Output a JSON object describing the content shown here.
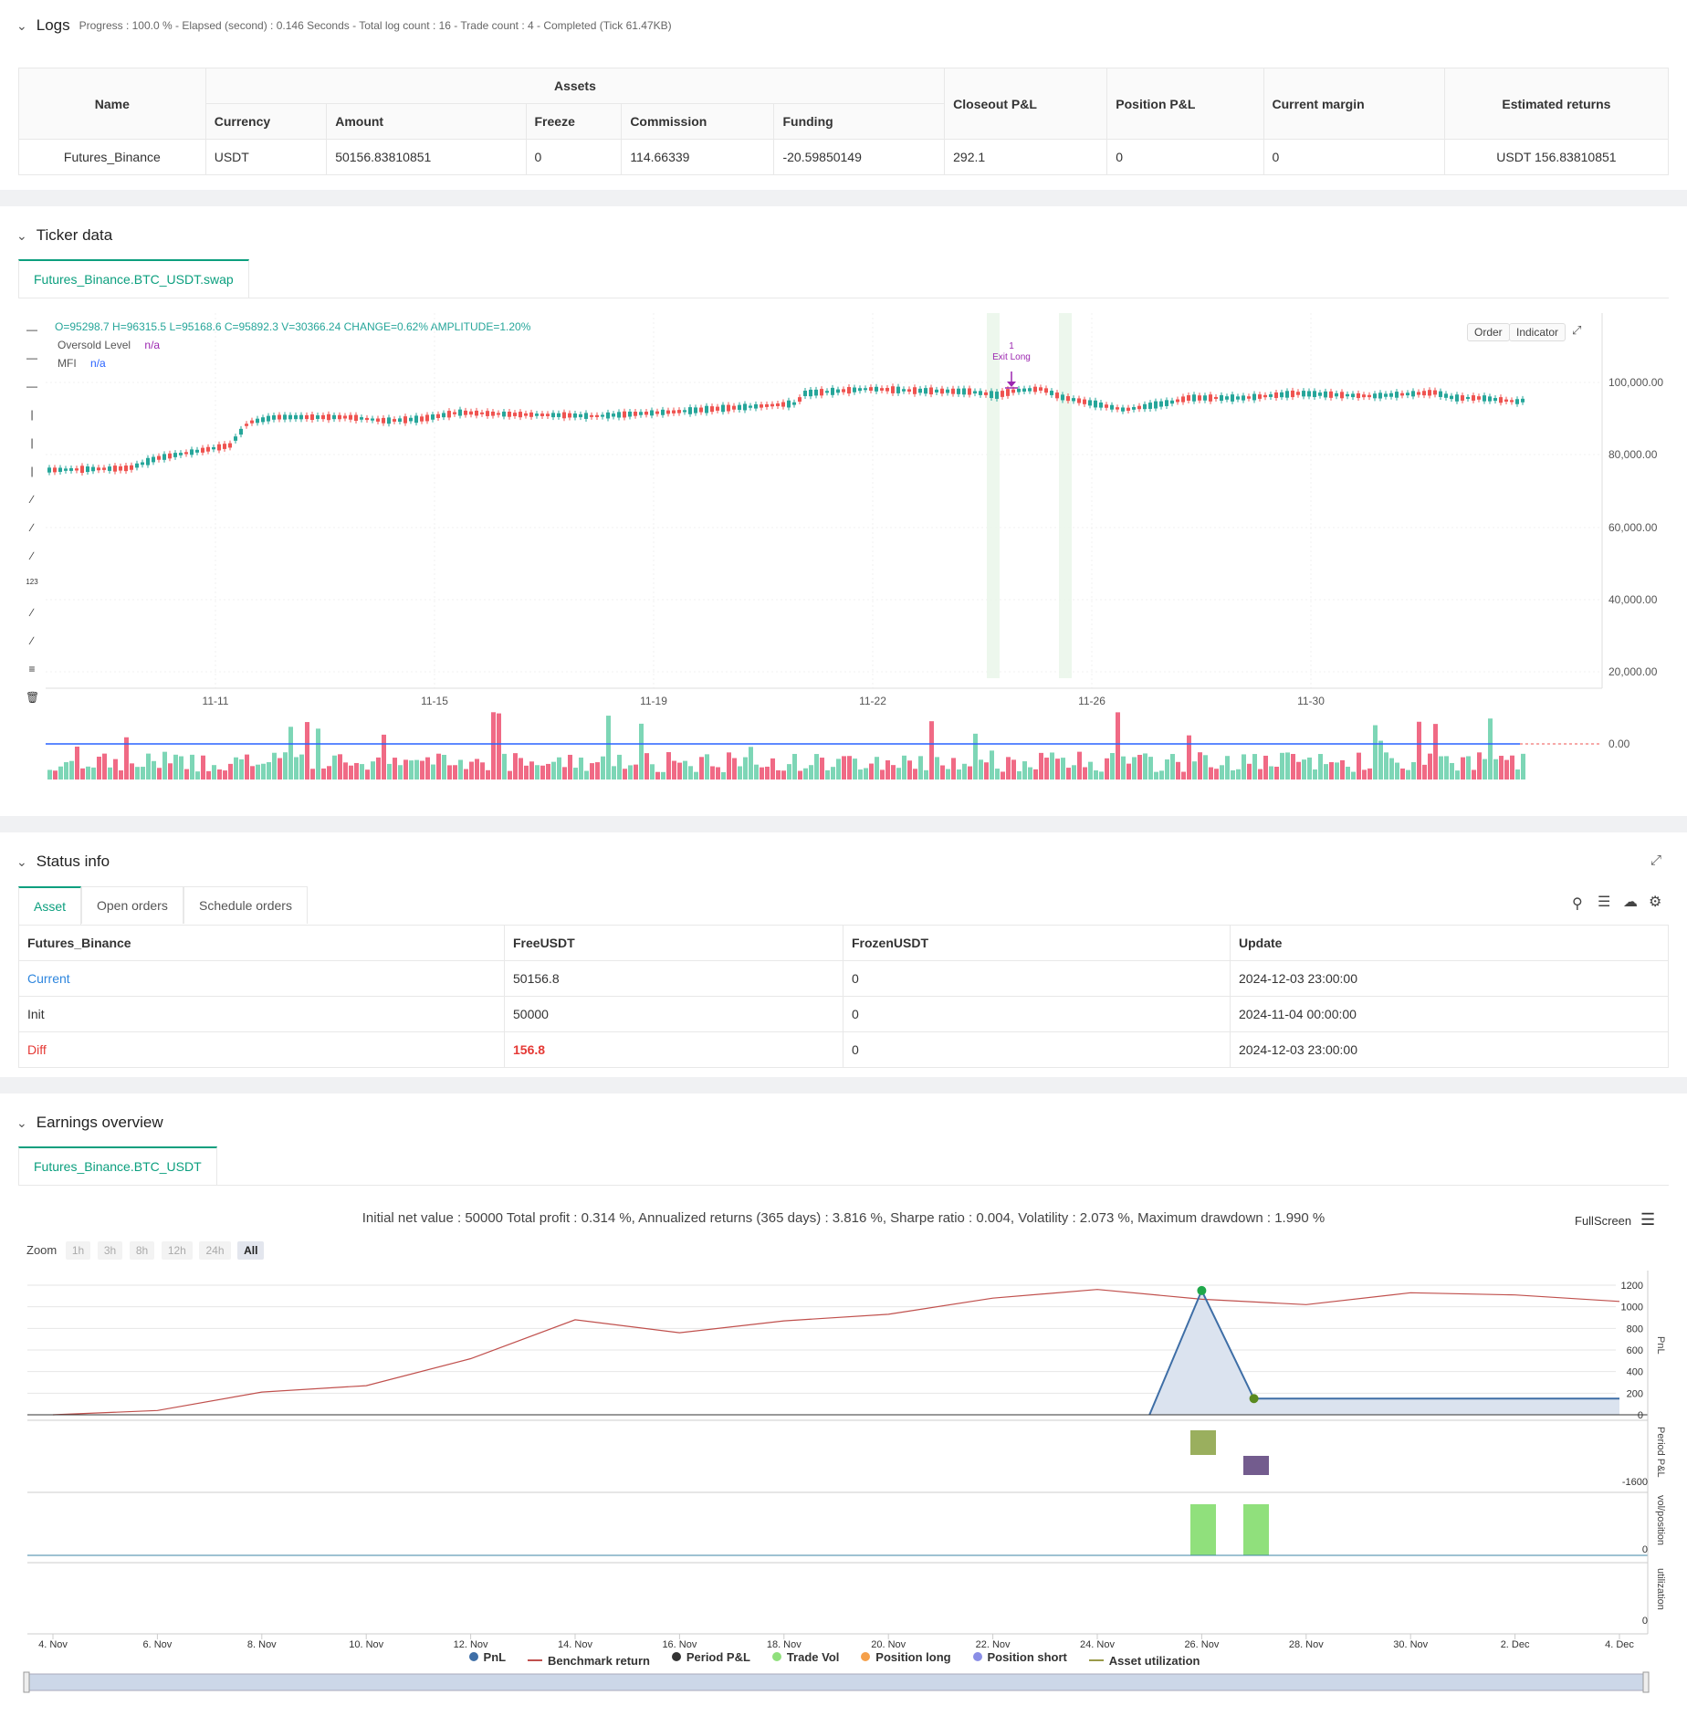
{
  "logs": {
    "title": "Logs",
    "summary": "Progress : 100.0 % - Elapsed (second) : 0.146  Seconds - Total log count : 16 - Trade count : 4 - Completed (Tick 61.47KB)",
    "table": {
      "h_name": "Name",
      "h_assets": "Assets",
      "h_currency": "Currency",
      "h_amount": "Amount",
      "h_freeze": "Freeze",
      "h_commission": "Commission",
      "h_funding": "Funding",
      "h_closeout": "Closeout P&L",
      "h_position": "Position P&L",
      "h_margin": "Current margin",
      "h_returns": "Estimated returns",
      "row": {
        "name": "Futures_Binance",
        "currency": "USDT",
        "amount": "50156.83810851",
        "freeze": "0",
        "commission": "114.66339",
        "funding": "-20.59850149",
        "closeout": "292.1",
        "position": "0",
        "margin": "0",
        "returns": "USDT 156.83810851"
      }
    }
  },
  "ticker": {
    "title": "Ticker data",
    "tab": "Futures_Binance.BTC_USDT.swap",
    "ohlc": "O=95298.7  H=96315.5  L=95168.6  C=95892.3  V=30366.24  CHANGE=0.62%  AMPLITUDE=1.20%",
    "oversold_label": "Oversold Level",
    "oversold_val": "n/a",
    "mfi_label": "MFI",
    "mfi_val": "n/a",
    "order_btn": "Order",
    "indicator_btn": "Indicator",
    "exit_mark": "1",
    "exit_label": "Exit Long",
    "y_ticks": [
      "100,000.00",
      "80,000.00",
      "60,000.00",
      "40,000.00",
      "20,000.00",
      "0.00"
    ],
    "x_ticks": [
      "11-11",
      "11-15",
      "11-19",
      "11-22",
      "11-26",
      "11-30"
    ]
  },
  "status": {
    "title": "Status info",
    "tabs": [
      "Asset",
      "Open orders",
      "Schedule orders"
    ],
    "headers": [
      "Futures_Binance",
      "FreeUSDT",
      "FrozenUSDT",
      "Update"
    ],
    "rows": [
      {
        "label": "Current",
        "free": "50156.8",
        "frozen": "0",
        "update": "2024-12-03 23:00:00"
      },
      {
        "label": "Init",
        "free": "50000",
        "frozen": "0",
        "update": "2024-11-04 00:00:00"
      },
      {
        "label": "Diff",
        "free": "156.8",
        "frozen": "0",
        "update": "2024-12-03 23:00:00"
      }
    ]
  },
  "earnings": {
    "title": "Earnings overview",
    "tab": "Futures_Binance.BTC_USDT",
    "summary": "Initial net value : 50000  Total profit : 0.314 %, Annualized returns (365 days) : 3.816 %, Sharpe ratio : 0.004, Volatility : 2.073 %, Maximum drawdown : 1.990 %",
    "fullscreen": "FullScreen",
    "zoom_label": "Zoom",
    "zoom_opts": [
      "1h",
      "3h",
      "8h",
      "12h",
      "24h",
      "All"
    ],
    "pnl_ticks": [
      "1200",
      "1000",
      "800",
      "600",
      "400",
      "200",
      "0"
    ],
    "period_tick": "-1600",
    "vol_tick": "0",
    "util_tick": "0",
    "axis_pnl": "PnL",
    "axis_period": "Period P&L",
    "axis_vol": "vol/position",
    "axis_util": "utilization",
    "x_ticks": [
      "4. Nov",
      "6. Nov",
      "8. Nov",
      "10. Nov",
      "12. Nov",
      "14. Nov",
      "16. Nov",
      "18. Nov",
      "20. Nov",
      "22. Nov",
      "24. Nov",
      "26. Nov",
      "28. Nov",
      "30. Nov",
      "2. Dec",
      "4. Dec"
    ],
    "legend": [
      {
        "name": "PnL",
        "color": "#3e6ea6",
        "kind": "dot"
      },
      {
        "name": "Benchmark return",
        "color": "#c0504d",
        "kind": "line"
      },
      {
        "name": "Period P&L",
        "color": "#333333",
        "kind": "dot"
      },
      {
        "name": "Trade Vol",
        "color": "#90e07c",
        "kind": "dot"
      },
      {
        "name": "Position long",
        "color": "#f5a04a",
        "kind": "dot"
      },
      {
        "name": "Position short",
        "color": "#8a8ee6",
        "kind": "dot"
      },
      {
        "name": "Asset utilization",
        "color": "#9a9a4a",
        "kind": "line"
      }
    ]
  },
  "colors": {
    "up": "#26a69a",
    "down": "#ef5350",
    "accent": "#0b9f7e",
    "pnl": "#3e6ea6",
    "bench": "#c0504d"
  },
  "chart_data": {
    "type": "line",
    "benchmark_return": {
      "x": [
        "4. Nov",
        "6. Nov",
        "8. Nov",
        "10. Nov",
        "12. Nov",
        "14. Nov",
        "16. Nov",
        "18. Nov",
        "20. Nov",
        "22. Nov",
        "24. Nov",
        "26. Nov",
        "28. Nov",
        "30. Nov",
        "2. Dec",
        "4. Dec"
      ],
      "values": [
        0,
        40,
        210,
        270,
        520,
        880,
        760,
        870,
        930,
        1080,
        1160,
        1070,
        1020,
        1130,
        1110,
        1050
      ]
    },
    "pnl": {
      "x": [
        "25. Nov",
        "26. Nov",
        "27. Nov",
        "4. Dec"
      ],
      "values": [
        0,
        1150,
        150,
        150
      ]
    },
    "ylim": [
      0,
      1200
    ]
  }
}
